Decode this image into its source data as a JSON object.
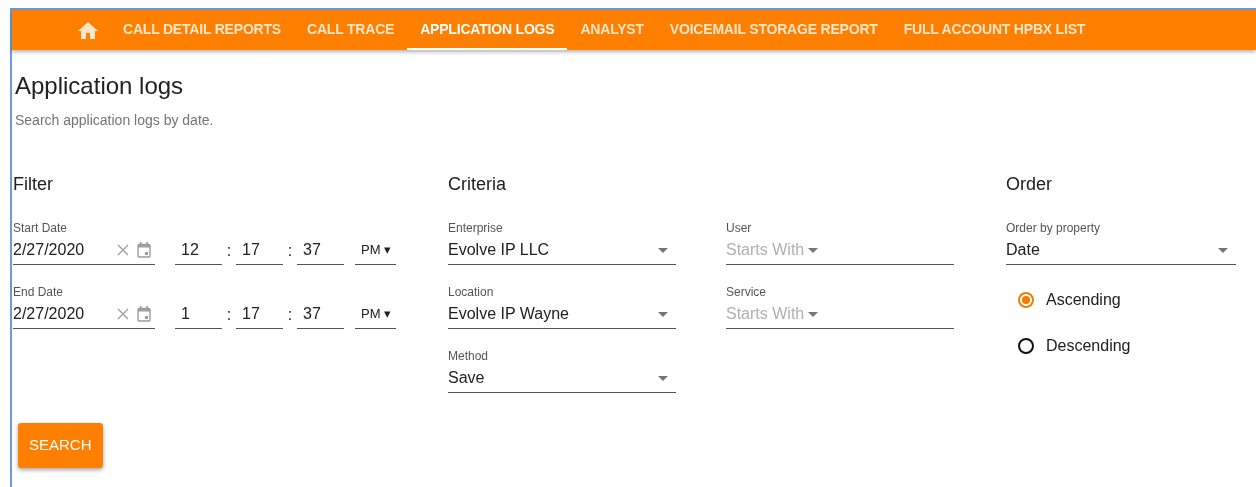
{
  "nav": {
    "tabs": [
      {
        "label": "CALL DETAIL REPORTS",
        "selected": false
      },
      {
        "label": "CALL TRACE",
        "selected": false
      },
      {
        "label": "APPLICATION LOGS",
        "selected": true
      },
      {
        "label": "ANALYST",
        "selected": false
      },
      {
        "label": "VOICEMAIL STORAGE REPORT",
        "selected": false
      },
      {
        "label": "FULL ACCOUNT HPBX LIST",
        "selected": false
      }
    ]
  },
  "page": {
    "title": "Application logs",
    "subtitle": "Search application logs by date."
  },
  "filter": {
    "heading": "Filter",
    "dates": [
      {
        "label": "Start Date",
        "value": "2/27/2020",
        "hour": "12",
        "minute": "17",
        "second": "37",
        "meridiem": "PM",
        "separator": ":",
        "caret": "▾"
      },
      {
        "label": "End Date",
        "value": "2/27/2020",
        "hour": "1",
        "minute": "17",
        "second": "37",
        "meridiem": "PM",
        "separator": ":",
        "caret": "▾"
      }
    ]
  },
  "criteria": {
    "heading": "Criteria",
    "columns": [
      [
        {
          "label": "Enterprise",
          "value": "Evolve IP LLC"
        },
        {
          "label": "Location",
          "value": "Evolve IP Wayne"
        },
        {
          "label": "Method",
          "value": "Save"
        }
      ],
      [
        {
          "label": "User",
          "placeholder": "Starts With"
        },
        {
          "label": "Service",
          "placeholder": "Starts With"
        }
      ]
    ]
  },
  "order": {
    "heading": "Order",
    "field": {
      "label": "Order by property",
      "value": "Date"
    },
    "options": [
      {
        "label": "Ascending",
        "selected": true
      },
      {
        "label": "Descending",
        "selected": false
      }
    ]
  },
  "search_button": "SEARCH"
}
